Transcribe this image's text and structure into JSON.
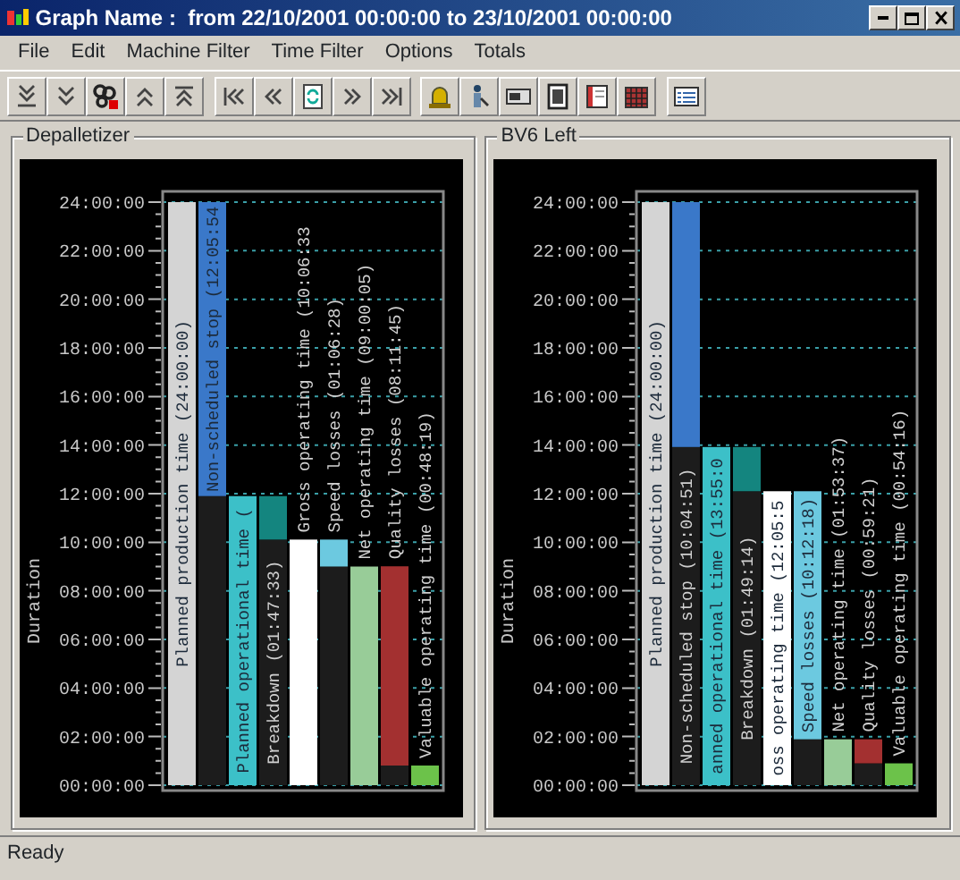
{
  "window": {
    "title": "Graph Name :  from 22/10/2001 00:00:00 to 23/10/2001 00:00:00"
  },
  "menu": [
    "File",
    "Edit",
    "Machine Filter",
    "Time Filter",
    "Options",
    "Totals"
  ],
  "panels": [
    {
      "title": "Depalletizer",
      "chart_data": {
        "type": "bar",
        "stacked": true,
        "orientation": "vertical",
        "grid": true,
        "ylabel": "Duration",
        "ylim": [
          0,
          24
        ],
        "yticks": [
          {
            "value": 0,
            "label": "00:00:00"
          },
          {
            "value": 2,
            "label": "02:00:00"
          },
          {
            "value": 4,
            "label": "04:00:00"
          },
          {
            "value": 6,
            "label": "06:00:00"
          },
          {
            "value": 8,
            "label": "08:00:00"
          },
          {
            "value": 10,
            "label": "10:00:00"
          },
          {
            "value": 12,
            "label": "12:00:00"
          },
          {
            "value": 14,
            "label": "14:00:00"
          },
          {
            "value": 16,
            "label": "16:00:00"
          },
          {
            "value": 18,
            "label": "18:00:00"
          },
          {
            "value": 20,
            "label": "20:00:00"
          },
          {
            "value": 22,
            "label": "22:00:00"
          },
          {
            "value": 24,
            "label": "24:00:00"
          }
        ],
        "categories": [
          "Planned production time (24:00:00)",
          "Non-scheduled stop (12:05:54",
          "Planned operational time (",
          "Breakdown (01:47:33)",
          "Gross operating time (10:06:33",
          "Speed losses (01:06:28)",
          "Net operating time (09:00:05)",
          "Quality losses (08:11:45)",
          "Valuable operating time (00:48:19)"
        ],
        "series": [
          {
            "color": "#1c1c1c",
            "values": [
              0,
              11.9,
              0,
              10.11,
              0,
              9,
              0,
              0.81,
              0
            ]
          },
          {
            "colors": [
              "#d4d4d4",
              "#3a78c9",
              "#3cc0c8",
              "#14857f",
              "#ffffff",
              "#6cc9e0",
              "#98cc98",
              "#a33030",
              "#6cc24a"
            ],
            "values": [
              24,
              12.1,
              11.9,
              1.79,
              10.11,
              1.11,
              9,
              8.2,
              0.81
            ]
          }
        ]
      }
    },
    {
      "title": "BV6 Left",
      "chart_data": {
        "type": "bar",
        "stacked": true,
        "orientation": "vertical",
        "grid": true,
        "ylabel": "Duration",
        "ylim": [
          0,
          24
        ],
        "yticks": [
          {
            "value": 0,
            "label": "00:00:00"
          },
          {
            "value": 2,
            "label": "02:00:00"
          },
          {
            "value": 4,
            "label": "04:00:00"
          },
          {
            "value": 6,
            "label": "06:00:00"
          },
          {
            "value": 8,
            "label": "08:00:00"
          },
          {
            "value": 10,
            "label": "10:00:00"
          },
          {
            "value": 12,
            "label": "12:00:00"
          },
          {
            "value": 14,
            "label": "14:00:00"
          },
          {
            "value": 16,
            "label": "16:00:00"
          },
          {
            "value": 18,
            "label": "18:00:00"
          },
          {
            "value": 20,
            "label": "20:00:00"
          },
          {
            "value": 22,
            "label": "22:00:00"
          },
          {
            "value": 24,
            "label": "24:00:00"
          }
        ],
        "categories": [
          "Planned production time (24:00:00)",
          "Non-scheduled stop (10:04:51)",
          "anned operational time (13:55:0",
          "Breakdown (01:49:14)",
          "oss operating time (12:05:5",
          "Speed losses (10:12:18)",
          "Net operating time (01:53:37)",
          "Quality losses (00:59:21)",
          "Valuable operating time (00:54:16)"
        ],
        "series": [
          {
            "color": "#1c1c1c",
            "values": [
              0,
              13.92,
              0,
              12.1,
              0,
              1.89,
              0,
              0.9,
              0
            ]
          },
          {
            "colors": [
              "#d4d4d4",
              "#3a78c9",
              "#3cc0c8",
              "#14857f",
              "#ffffff",
              "#6cc9e0",
              "#98cc98",
              "#a33030",
              "#6cc24a"
            ],
            "values": [
              24,
              10.08,
              13.92,
              1.82,
              12.1,
              10.21,
              1.89,
              0.99,
              0.9
            ]
          }
        ]
      }
    }
  ],
  "status_bar": "Ready"
}
